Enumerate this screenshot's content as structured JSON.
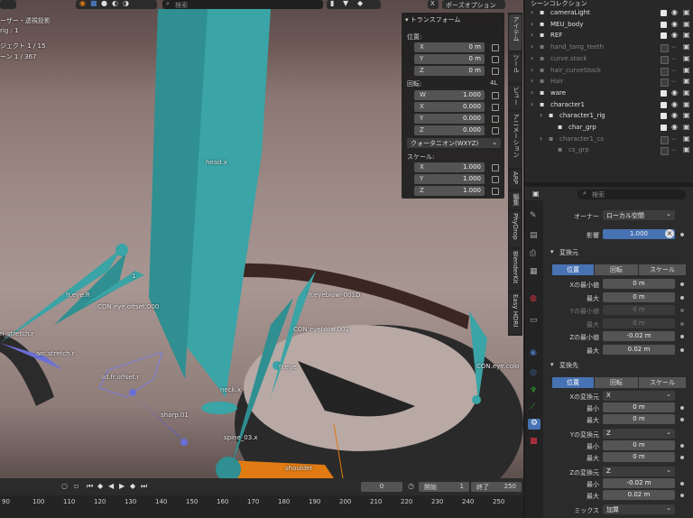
{
  "viewport": {
    "overlay_lines": [
      "ーザー・透視投影",
      "rig : 1",
      "ジェクト   1 / 15",
      "ーン         1 / 367"
    ],
    "pose_mode_label": "ポーズオプション",
    "search_placeholder": "検索",
    "bone_labels": {
      "head": "head.x",
      "neck": "neck.x",
      "spine03": "spine_03.x",
      "shoulder": "shoulder",
      "fr_eye_r": "fr.eye.R",
      "con_eye_offset": "CON.eye.offset.000",
      "eyebrow001": "fr.eyeblow_001D",
      "con_eyeblow": "CON.eyeblow.001",
      "fr_eye": "fr.eye",
      "con_eyeco": "CON.eye.colo",
      "stretch": "n_stretch.r",
      "arc": "arc.stretch.r",
      "sharp": "sharp.01",
      "eyebrow_small": "1",
      "fr_lids": "lid.fr.offset.r"
    }
  },
  "npanel": {
    "title": "トランスフォーム",
    "location_label": "位置:",
    "loc": [
      {
        "k": "X",
        "v": "0 m"
      },
      {
        "k": "Y",
        "v": "0 m"
      },
      {
        "k": "Z",
        "v": "0 m"
      }
    ],
    "rotation_label": "回転:",
    "rotation_mode_short": "4L",
    "rot": [
      {
        "k": "W",
        "v": "1.000"
      },
      {
        "k": "X",
        "v": "0.000"
      },
      {
        "k": "Y",
        "v": "0.000"
      },
      {
        "k": "Z",
        "v": "0.000"
      }
    ],
    "rotation_mode": "クォータニオン(WXYZ)",
    "scale_label": "スケール:",
    "scale": [
      {
        "k": "X",
        "v": "1.000"
      },
      {
        "k": "Y",
        "v": "1.000"
      },
      {
        "k": "Z",
        "v": "1.000"
      }
    ]
  },
  "side_tabs": [
    "アイテム",
    "ツール",
    "ビュー",
    "アニメーション",
    "ARP",
    "編集",
    "PhyDrop",
    "BlenderKit",
    "Easy HDRI"
  ],
  "outliner": {
    "header": "シーンコレクション",
    "rows": [
      {
        "name": "cameraLight",
        "active": true,
        "indent": 1
      },
      {
        "name": "MEU_body",
        "active": true,
        "indent": 1
      },
      {
        "name": "REF",
        "active": true,
        "indent": 1
      },
      {
        "name": "hand_tang_teeth",
        "active": false,
        "indent": 1
      },
      {
        "name": "curve.stock",
        "active": false,
        "indent": 1
      },
      {
        "name": "hair_curveStock",
        "active": false,
        "indent": 1
      },
      {
        "name": "Hair",
        "active": false,
        "indent": 1
      },
      {
        "name": "ware",
        "active": true,
        "indent": 1
      },
      {
        "name": "character1",
        "active": true,
        "indent": 1
      },
      {
        "name": "character1_rig",
        "active": true,
        "indent": 2
      },
      {
        "name": "char_grp",
        "active": true,
        "indent": 3
      },
      {
        "name": "character1_cs",
        "active": false,
        "indent": 2
      },
      {
        "name": "cs_grp",
        "active": false,
        "indent": 3
      }
    ],
    "badges": {
      "meu": "2",
      "ware": "4",
      "char": "72",
      "cs": "134"
    }
  },
  "properties": {
    "search_placeholder": "検索",
    "owner_label": "オーナー",
    "owner_value": "ローカル空間",
    "influence_label": "影響",
    "influence_value": "1.000",
    "from_section": "変換元",
    "from_tabs": [
      "位置",
      "回転",
      "スケール"
    ],
    "from_rows": [
      {
        "label": "Xの最小値",
        "value": "0 m",
        "dim": false
      },
      {
        "label": "最大",
        "value": "0 m",
        "dim": false
      },
      {
        "label": "Yの最小値",
        "value": "0 m",
        "dim": true
      },
      {
        "label": "最大",
        "value": "0 m",
        "dim": true
      },
      {
        "label": "Zの最小値",
        "value": "-0.02 m",
        "dim": false
      },
      {
        "label": "最大",
        "value": "0.02 m",
        "dim": false
      }
    ],
    "to_section": "変換先",
    "to_tabs": [
      "位置",
      "回転",
      "スケール"
    ],
    "x_map_label": "Xの変換元",
    "x_map_value": "X",
    "x_rows": [
      {
        "label": "最小",
        "value": "0 m"
      },
      {
        "label": "最大",
        "value": "0 m"
      }
    ],
    "y_map_label": "Yの変換元",
    "y_map_value": "Z",
    "y_rows": [
      {
        "label": "最小",
        "value": "0 m"
      },
      {
        "label": "最大",
        "value": "0 m"
      }
    ],
    "z_map_label": "Zの変換元",
    "z_map_value": "Z",
    "z_rows": [
      {
        "label": "最小",
        "value": "-0.02 m"
      },
      {
        "label": "最大",
        "value": "0.02 m"
      }
    ],
    "mix_label": "ミックス",
    "mix_value": "加算"
  },
  "timeline": {
    "current_frame": "0",
    "start_label": "開始",
    "start_value": "1",
    "end_label": "終了",
    "end_value": "250",
    "ticks": [
      "90",
      "100",
      "110",
      "120",
      "130",
      "140",
      "150",
      "160",
      "170",
      "180",
      "190",
      "200",
      "210",
      "220",
      "230",
      "240",
      "250"
    ]
  },
  "colors": {
    "bone": "#3aa4a6",
    "bone_selected": "#2f8f91",
    "accent": "#4772b3",
    "orange": "#e07a12"
  }
}
